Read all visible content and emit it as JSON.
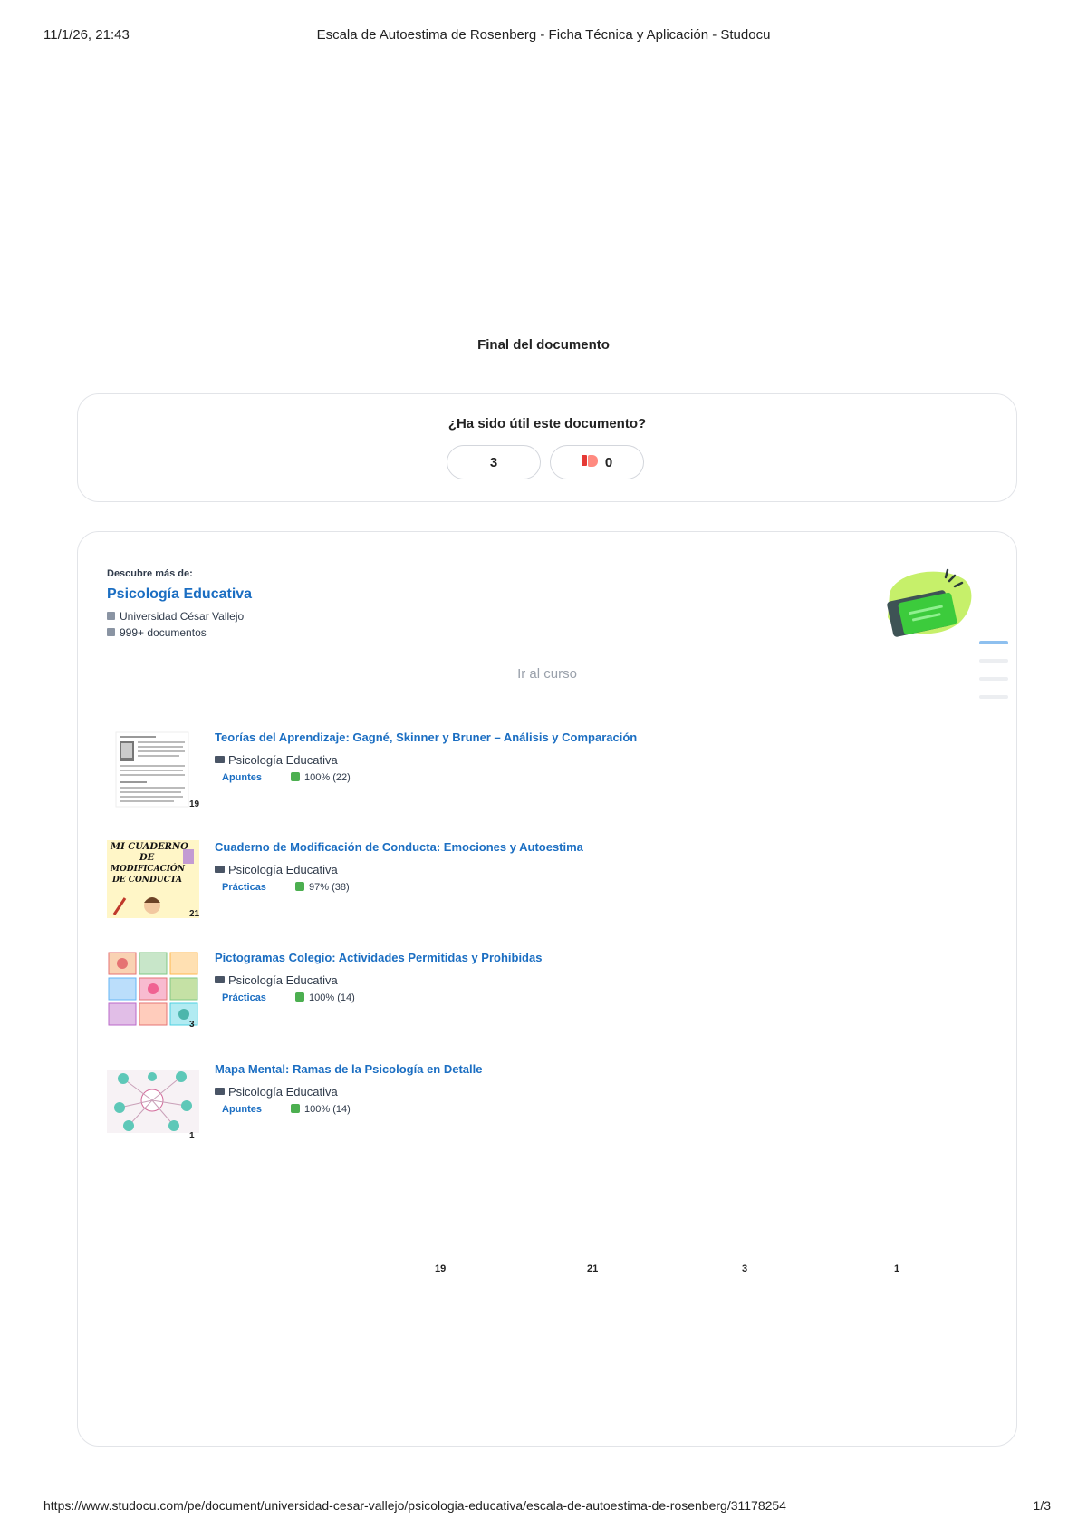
{
  "print_header": {
    "datetime": "11/1/26, 21:43",
    "title": "Escala de Autoestima de Rosenberg - Ficha Técnica y Aplicación - Studocu"
  },
  "end_of_document": "Final del documento",
  "feedback": {
    "question": "¿Ha sido útil este documento?",
    "likes": "3",
    "dislikes": "0"
  },
  "course": {
    "discover_label": "Descubre más de:",
    "name": "Psicología Educativa",
    "university": "Universidad César Vallejo",
    "documents": "999+ documentos",
    "go_label": "Ir al curso"
  },
  "related_docs": [
    {
      "title": "Teorías del Aprendizaje: Gagné, Skinner y Bruner – Análisis y Comparación",
      "course": "Psicología Educativa",
      "type": "Apuntes",
      "rating": "100% (22)",
      "pages": "19"
    },
    {
      "title": "Cuaderno de Modificación de Conducta: Emociones y Autoestima",
      "course": "Psicología Educativa",
      "type": "Prácticas",
      "rating": "97% (38)",
      "pages": "21",
      "thumb_text": [
        "MI CUADERNO",
        "DE",
        "MODIFICACIÓN",
        "DE CONDUCTA"
      ]
    },
    {
      "title": "Pictogramas Colegio: Actividades Permitidas y Prohibidas",
      "course": "Psicología Educativa",
      "type": "Prácticas",
      "rating": "100% (14)",
      "pages": "3"
    },
    {
      "title": "Mapa Mental: Ramas de la Psicología en Detalle",
      "course": "Psicología Educativa",
      "type": "Apuntes",
      "rating": "100% (14)",
      "pages": "1"
    }
  ],
  "bottom_page_counts": [
    "19",
    "21",
    "3",
    "1"
  ],
  "print_footer": {
    "url": "https://www.studocu.com/pe/document/universidad-cesar-vallejo/psicologia-educativa/escala-de-autoestima-de-rosenberg/31178254",
    "page": "1/3"
  },
  "colors": {
    "link_blue": "#1b6ec2",
    "like_green": "#4caf50",
    "dislike_red": "#e53935",
    "card_border": "#e2e4e8"
  }
}
